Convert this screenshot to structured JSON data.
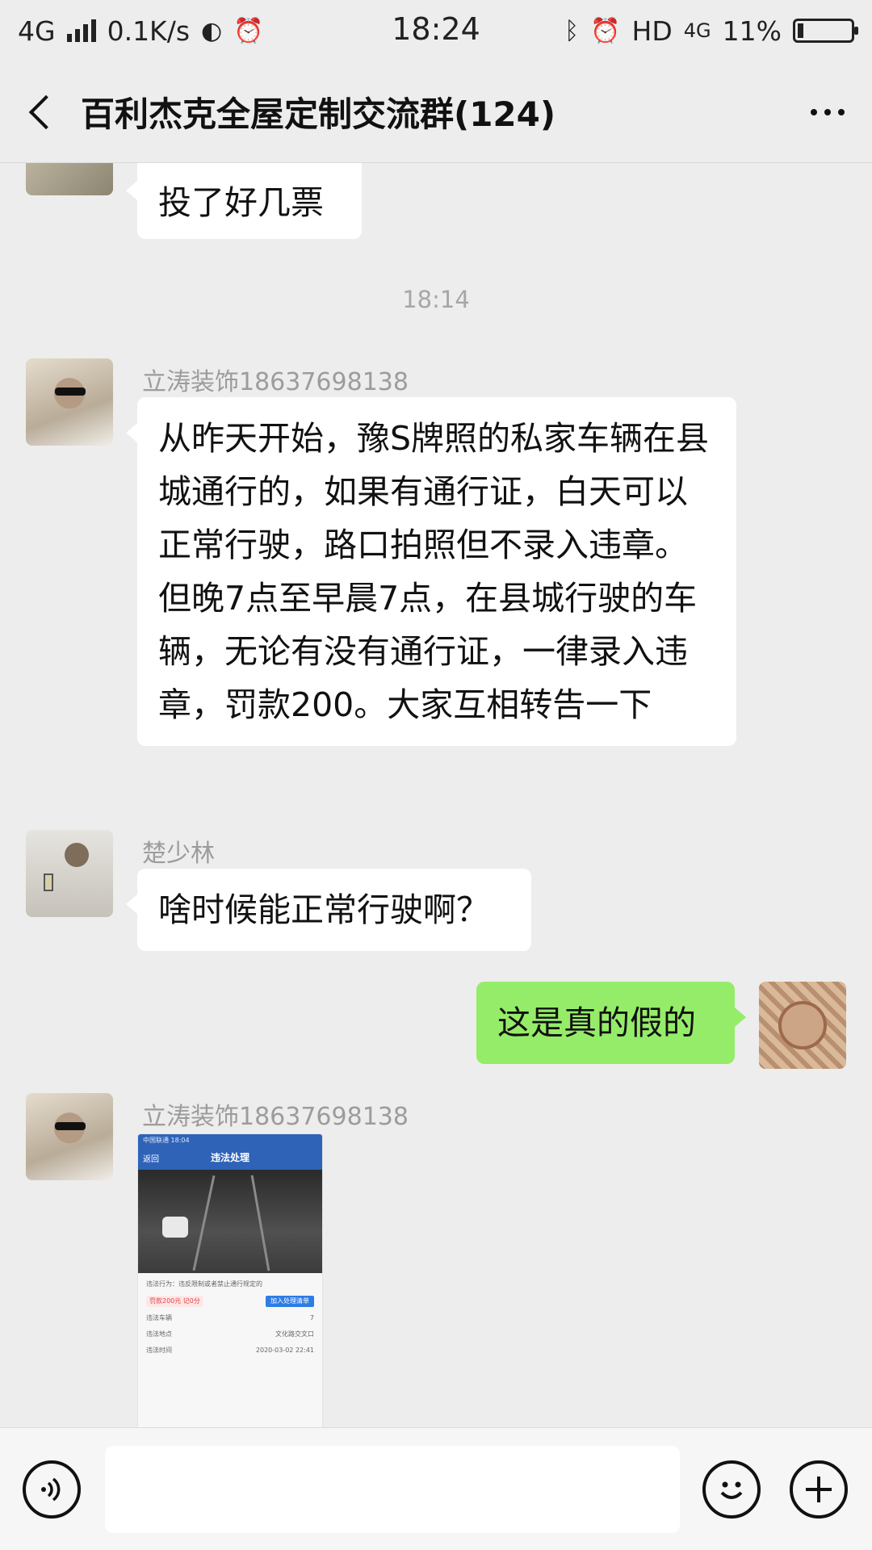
{
  "status_bar": {
    "network": "4G",
    "speed": "0.1K/s",
    "time": "18:24",
    "hd": "HD",
    "network_right": "4G",
    "battery": "11%",
    "battery_level": 0.11
  },
  "header": {
    "title": "百利杰克全屋定制交流群(124)"
  },
  "messages": {
    "partial_text": "投了好几票",
    "timestamp": "18:14",
    "msg1_sender": "立涛装饰18637698138",
    "msg1_text": "从昨天开始，豫S牌照的私家车辆在县城通行的，如果有通行证，白天可以正常行驶，路口拍照但不录入违章。但晚7点至早晨7点，在县城行驶的车辆，无论有没有通行证，一律录入违章，罚款200。大家互相转告一下",
    "msg2_sender": "楚少林",
    "msg2_text": "啥时候能正常行驶啊？",
    "msg3_text": "这是真的假的",
    "msg4_sender": "立涛装饰18637698138"
  },
  "image_message": {
    "status_text": "中国联通 18:04",
    "back": "返回",
    "title": "违法处理",
    "violation_label": "违法行为：违反限制或者禁止通行规定的",
    "fine": "罚款200元 记0分",
    "add_button": "加入处理清单",
    "rows": [
      {
        "label": "违法车辆",
        "value": "7"
      },
      {
        "label": "违法地点",
        "value": "文化路交文口"
      },
      {
        "label": "违法时间",
        "value": "2020-03-02 22:41"
      }
    ]
  },
  "input_bar": {
    "placeholder": ""
  },
  "colors": {
    "background": "#ededed",
    "sent_bubble": "#95ec69",
    "received_bubble": "#ffffff"
  }
}
